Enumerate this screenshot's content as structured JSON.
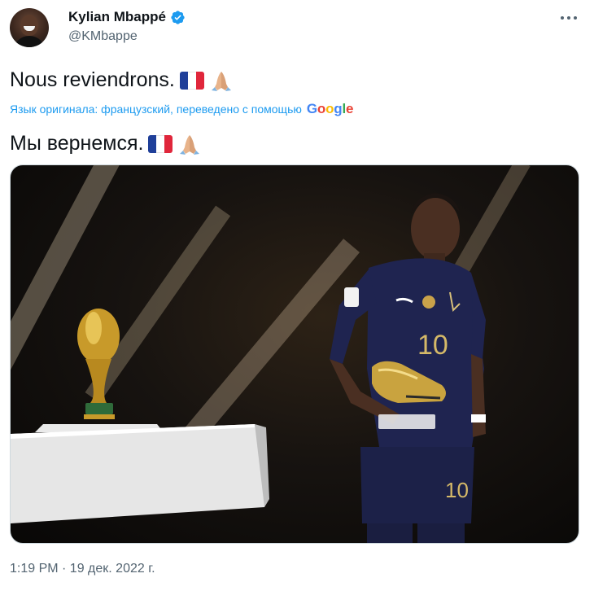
{
  "author": {
    "display_name": "Kylian Mbappé",
    "handle": "@KMbappe",
    "verified": true
  },
  "tweet": {
    "text": "Nous reviendrons.",
    "translation_note": "Язык оригинала: французский, переведено с помощью",
    "translation_provider": "Google",
    "translated_text": "Мы вернемся.",
    "emoji": [
      "flag-france",
      "folded-hands"
    ]
  },
  "media": {
    "jersey_number": "10",
    "alt": "photo"
  },
  "timestamp": "1:19 PM · 19 дек. 2022 г.",
  "colors": {
    "link": "#1d9bf0",
    "text": "#0f1419",
    "secondary": "#536471",
    "verified": "#1d9bf0"
  }
}
